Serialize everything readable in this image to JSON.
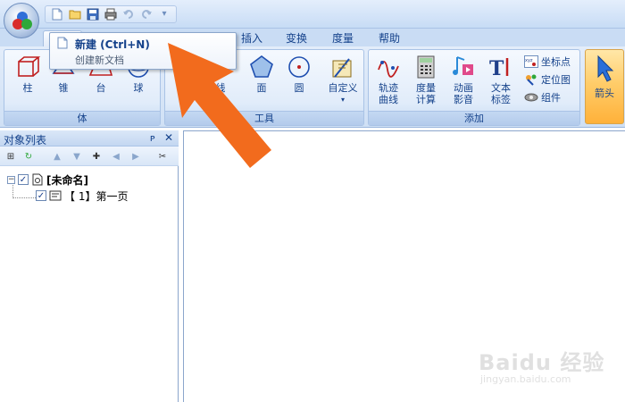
{
  "quick_access": {
    "icons": [
      "new-doc-icon",
      "open-folder-icon",
      "save-icon",
      "print-icon",
      "undo-icon",
      "redo-icon",
      "customize-icon"
    ]
  },
  "tabs": [
    {
      "label": "插入"
    },
    {
      "label": "变换"
    },
    {
      "label": "度量"
    },
    {
      "label": "帮助"
    }
  ],
  "dropdown": {
    "title": "新建 (Ctrl+N)",
    "description": "创建新文档"
  },
  "ribbon": {
    "group_body": {
      "label": "体",
      "buttons": [
        {
          "label": "柱"
        },
        {
          "label": "锥"
        },
        {
          "label": "台"
        },
        {
          "label": "球"
        }
      ]
    },
    "group_tools": {
      "label": "工具",
      "buttons": [
        {
          "label": "线"
        },
        {
          "label": "面"
        },
        {
          "label": "圆"
        },
        {
          "label": "自定义"
        }
      ]
    },
    "group_add": {
      "label": "添加",
      "buttons": [
        {
          "label": "轨迹\n曲线"
        },
        {
          "label": "度量\n计算"
        },
        {
          "label": "动画\n影音"
        },
        {
          "label": "文本\n标签"
        }
      ],
      "small_buttons": [
        {
          "label": "坐标点"
        },
        {
          "label": "定位图"
        },
        {
          "label": "组件"
        }
      ]
    },
    "arrow_button": {
      "label": "箭头"
    }
  },
  "panel": {
    "title": "对象列表",
    "pin": "ᴘ",
    "close": "✕",
    "tree": {
      "root": {
        "label": "[未命名]",
        "checked": true
      },
      "child": {
        "label": "【 1】第一页",
        "checked": true
      }
    }
  },
  "watermark": {
    "brand": "Baidu 经验",
    "sub": "jingyan.baidu.com"
  },
  "colors": {
    "accent": "#15428b",
    "ribbon_bg": "#dbe8f8",
    "pointer_arrow": "#f26b1d",
    "active_button": "#ffcd6a"
  }
}
